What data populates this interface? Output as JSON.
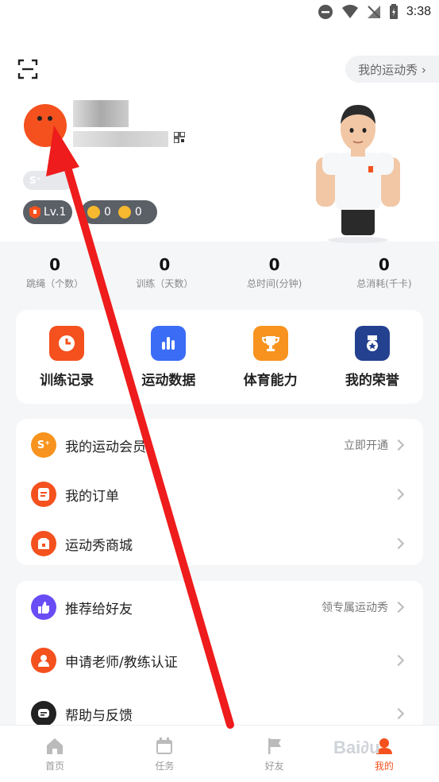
{
  "status_bar": {
    "time": "3:38"
  },
  "header": {
    "show_link": "我的运动秀 ›",
    "level": "Lv.1",
    "coins": "0",
    "energy": "0"
  },
  "stats": [
    {
      "value": "0",
      "label": "跳绳（个数）"
    },
    {
      "value": "0",
      "label": "训练（天数）"
    },
    {
      "value": "0",
      "label": "总时间(分钟)"
    },
    {
      "value": "0",
      "label": "总消耗(千卡)"
    }
  ],
  "shortcuts": [
    {
      "label": "训练记录",
      "icon": "clock-icon",
      "color": "#f4511e"
    },
    {
      "label": "运动数据",
      "icon": "bar-chart-icon",
      "color": "#3b6cf5"
    },
    {
      "label": "体育能力",
      "icon": "trophy-icon",
      "color": "#f7931e"
    },
    {
      "label": "我的荣誉",
      "icon": "medal-icon",
      "color": "#23418f"
    }
  ],
  "menu_group_1": [
    {
      "label": "我的运动会员",
      "right": "立即开通",
      "icon": "vip-icon",
      "color": "#f7931e"
    },
    {
      "label": "我的订单",
      "right": "",
      "icon": "order-icon",
      "color": "#f4511e"
    },
    {
      "label": "运动秀商城",
      "right": "",
      "icon": "shop-icon",
      "color": "#f4511e"
    }
  ],
  "menu_group_2": [
    {
      "label": "推荐给好友",
      "right": "领专属运动秀",
      "icon": "thumbs-up-icon",
      "color": "#6a4cf5"
    },
    {
      "label": "申请老师/教练认证",
      "right": "",
      "icon": "user-icon",
      "color": "#f4511e"
    },
    {
      "label": "帮助与反馈",
      "right": "",
      "icon": "chat-icon",
      "color": "#222222"
    }
  ],
  "bottom_nav": [
    {
      "label": "首页",
      "icon": "home-icon"
    },
    {
      "label": "任务",
      "icon": "calendar-icon"
    },
    {
      "label": "好友",
      "icon": "flag-icon"
    },
    {
      "label": "我的",
      "icon": "profile-icon"
    }
  ],
  "colors": {
    "accent": "#f4511e",
    "arrow": "#ee1c1c"
  }
}
